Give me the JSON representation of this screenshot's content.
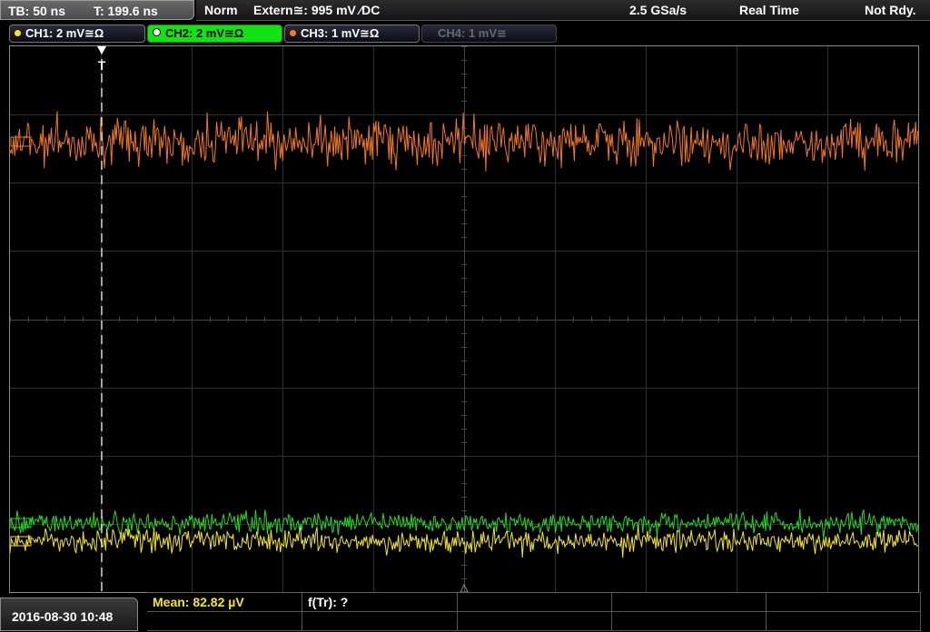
{
  "header": {
    "timebase": "TB: 50 ns",
    "trigger_time": "T: 199.6 ns",
    "mode": "Norm",
    "trigger_source": "Extern≅: 995 mV ⁄DC",
    "sample_rate": "2.5 GSa/s",
    "acq_mode": "Real Time",
    "status": "Not Rdy."
  },
  "channels": [
    {
      "label": "CH1: 2 mV≅Ω",
      "color": "#f7e81a",
      "active": false,
      "enabled": true
    },
    {
      "label": "CH2: 2 mV≅Ω",
      "color": "#13e313",
      "active": true,
      "enabled": true
    },
    {
      "label": "CH3: 1 mV≅Ω",
      "color": "#ff7a1a",
      "active": false,
      "enabled": true
    },
    {
      "label": "CH4: 1 mV≅",
      "color": "#555555",
      "active": false,
      "enabled": false
    }
  ],
  "footer": {
    "date": "2016-08-30 10:48",
    "measurement": "Mean: 82.82 µV",
    "measurement_color": "#f7e81a",
    "frequency": "f(Tr): ?"
  },
  "trace_colors": {
    "ch1": "#f7e81a",
    "ch2": "#22dd22",
    "ch3": "#f47a1e"
  },
  "trigger_marker": "T"
}
